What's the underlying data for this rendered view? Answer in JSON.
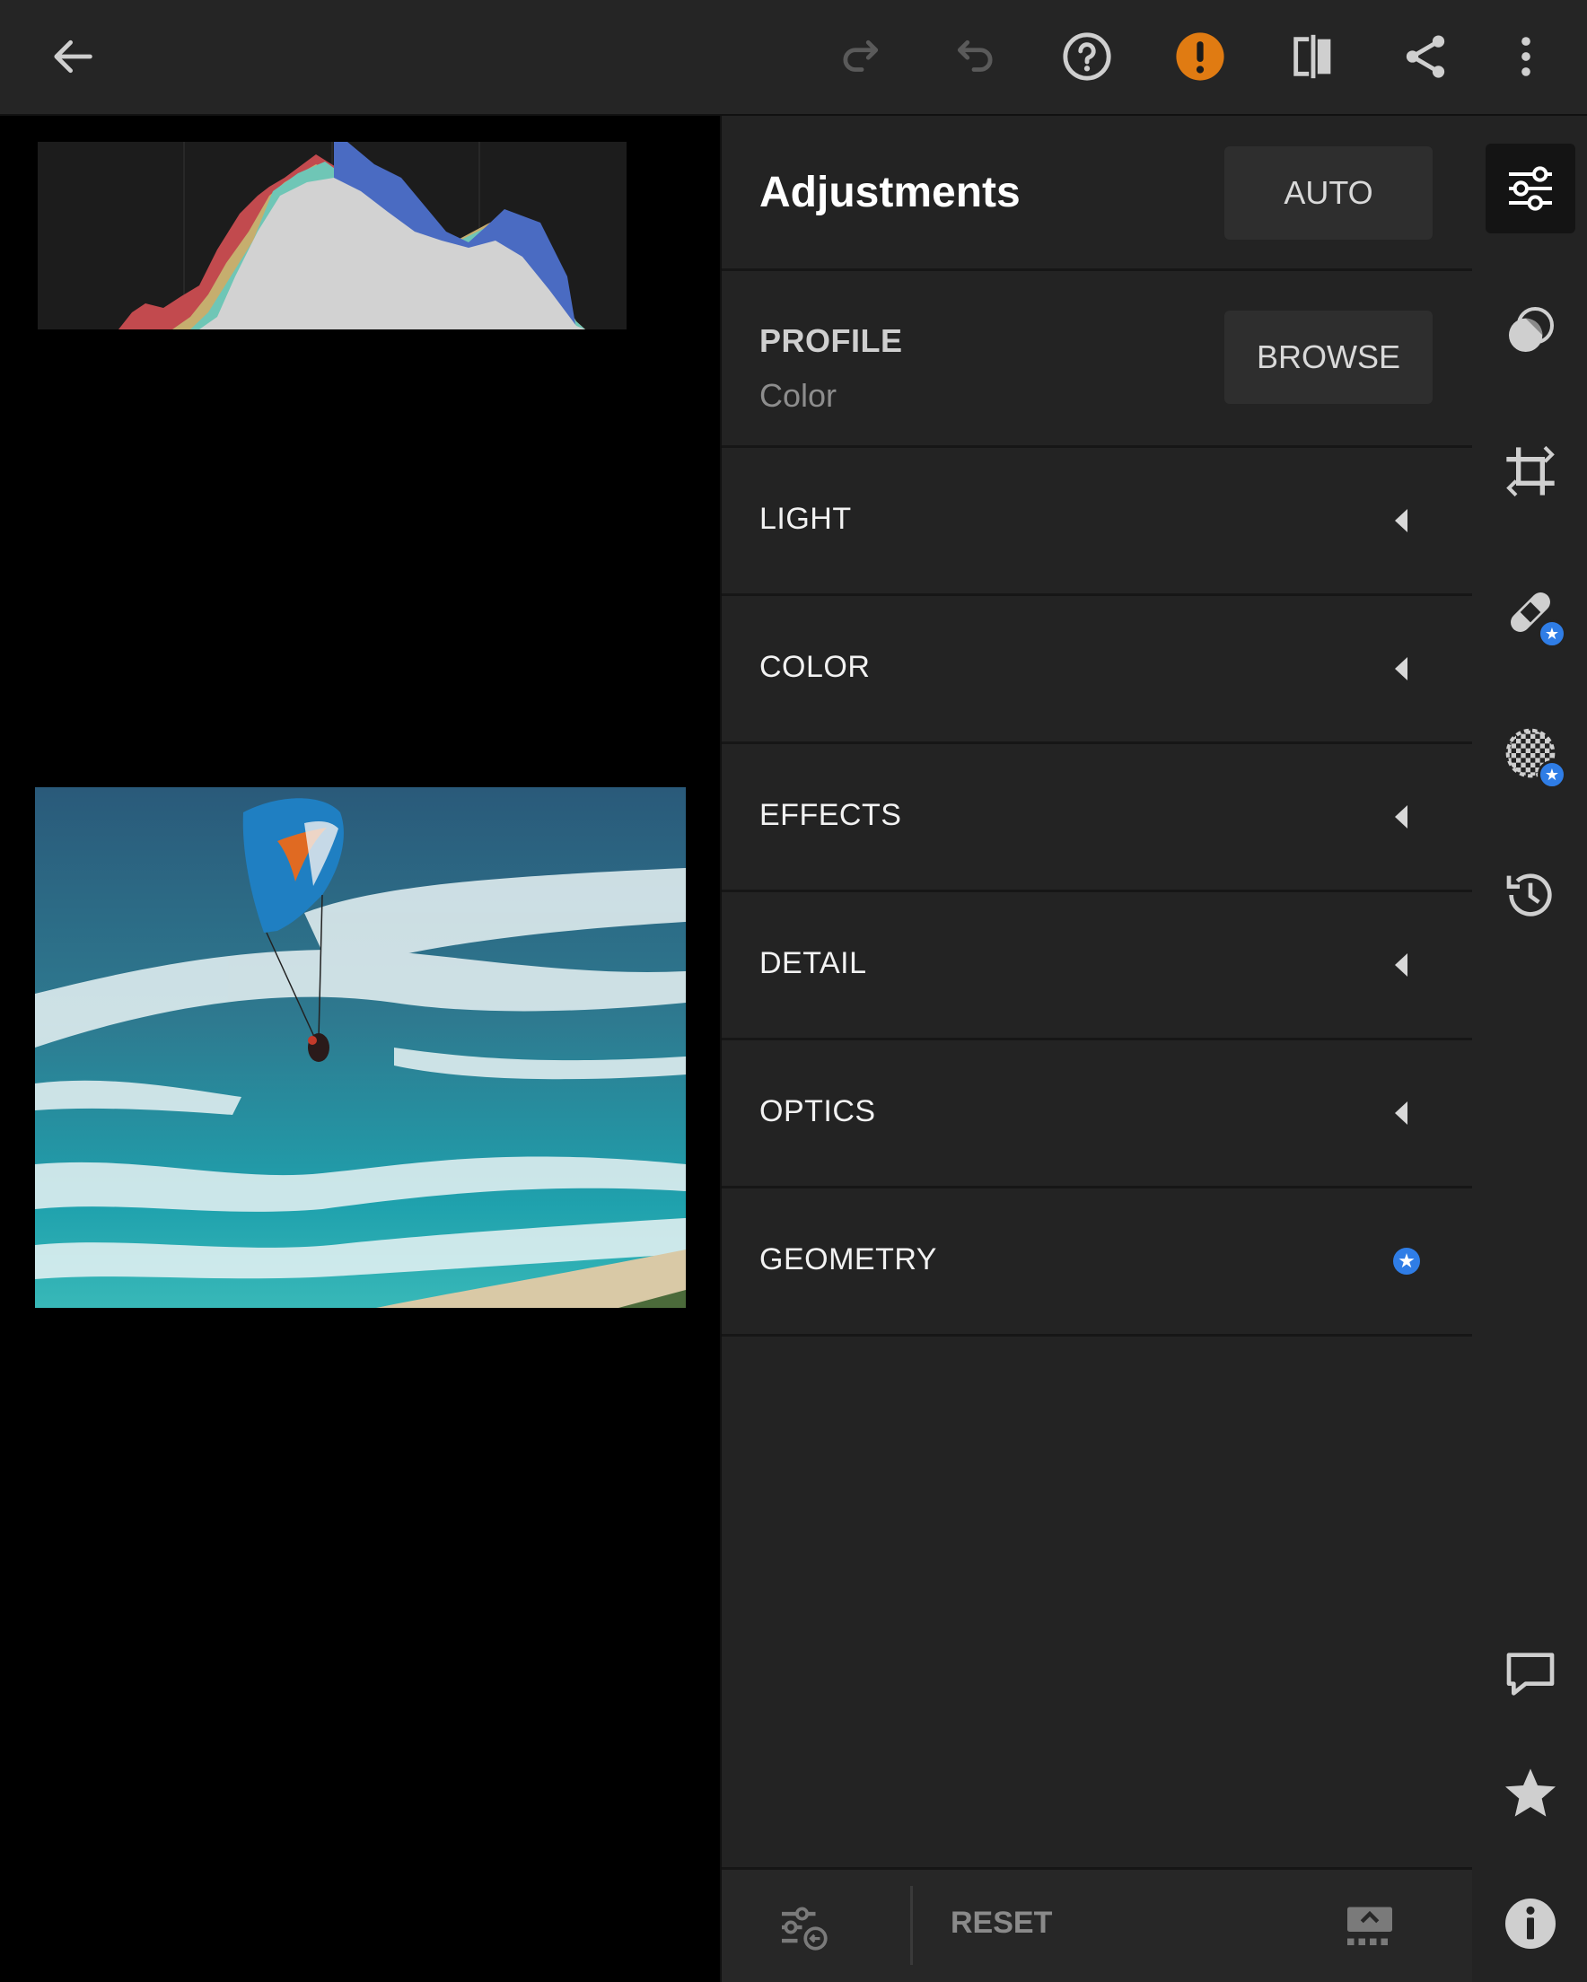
{
  "panel": {
    "title": "Adjustments",
    "auto_label": "AUTO",
    "profile": {
      "label": "PROFILE",
      "value": "Color",
      "browse_label": "BROWSE"
    },
    "sections": [
      {
        "label": "LIGHT",
        "state": "collapsed"
      },
      {
        "label": "COLOR",
        "state": "collapsed"
      },
      {
        "label": "EFFECTS",
        "state": "collapsed"
      },
      {
        "label": "DETAIL",
        "state": "collapsed"
      },
      {
        "label": "OPTICS",
        "state": "collapsed"
      },
      {
        "label": "GEOMETRY",
        "state": "premium"
      }
    ],
    "reset_label": "RESET"
  },
  "toolbar": {
    "icons": [
      "back-arrow-icon",
      "redo-icon",
      "undo-icon",
      "help-icon",
      "warning-icon",
      "compare-icon",
      "share-icon",
      "more-icon"
    ]
  },
  "rail": {
    "icons": [
      "edit-sliders-icon",
      "selective-icon",
      "crop-icon",
      "healing-icon",
      "masking-icon",
      "history-icon",
      "comment-icon",
      "rating-star-icon",
      "info-icon"
    ]
  },
  "colors": {
    "accent_orange": "#e07b12",
    "premium_blue": "#2f7de6",
    "panel_bg": "#232323"
  }
}
